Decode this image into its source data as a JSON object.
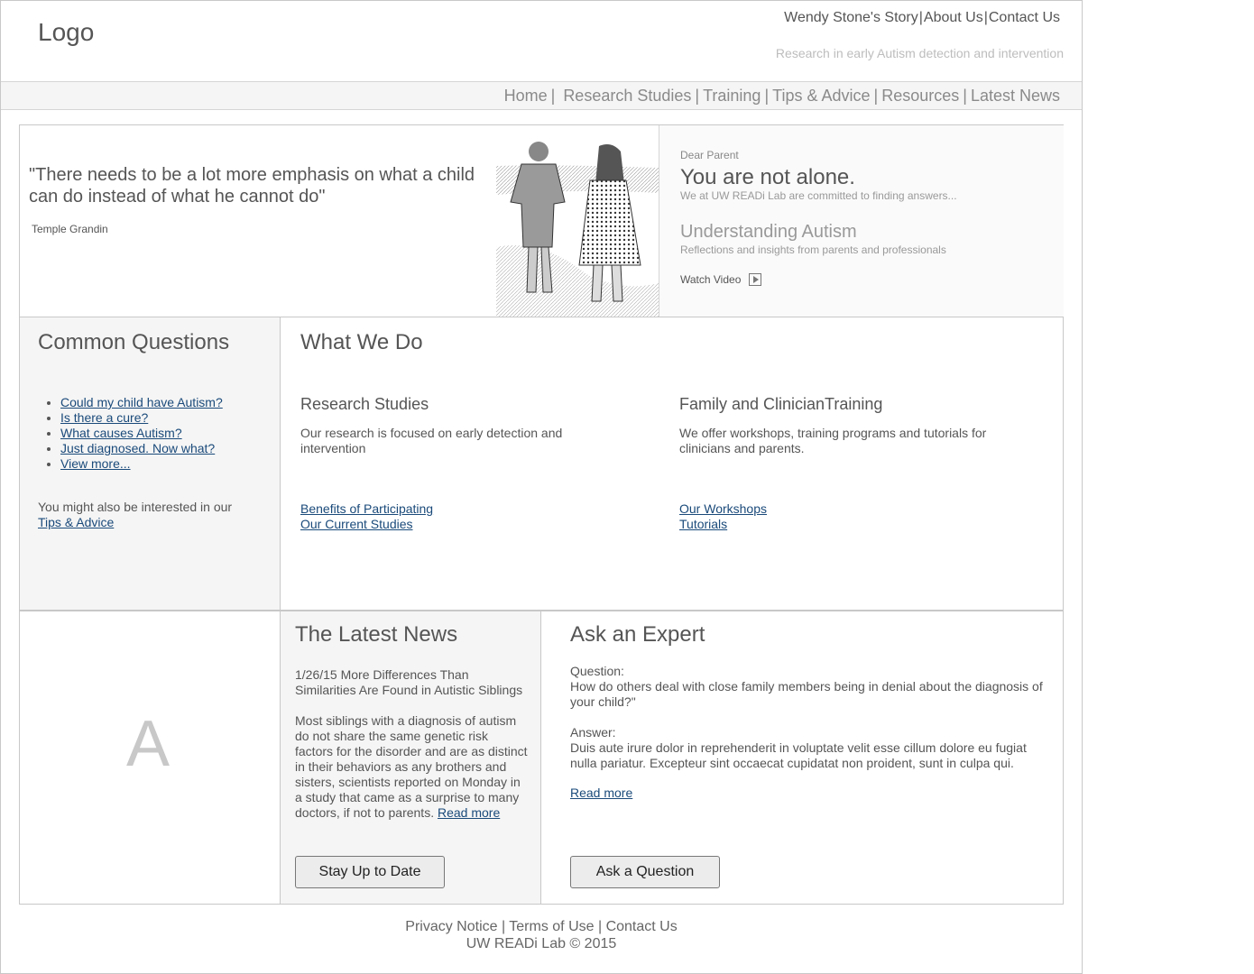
{
  "header": {
    "logo": "Logo",
    "top_links": [
      "Wendy Stone's Story",
      "About Us",
      "Contact Us"
    ],
    "tagline": "Research in early Autism detection and intervention"
  },
  "nav": {
    "items": [
      "Home",
      "Research Studies",
      "Training",
      "Tips & Advice",
      "Resources",
      "Latest News"
    ]
  },
  "hero": {
    "quote": "\"There needs to be a lot more emphasis on what a child can do instead of what he cannot do\"",
    "author": "Temple Grandin",
    "greeting": "Dear Parent",
    "headline": "You are not alone.",
    "headline_sub": "We at UW READi Lab are committed to finding answers...",
    "video_title": "Understanding Autism",
    "video_sub": "Reflections and insights from parents and professionals",
    "watch_label": "Watch Video"
  },
  "common_questions": {
    "title": "Common Questions",
    "items": [
      "Could my child have Autism?",
      "Is there a cure?",
      "What causes Autism?",
      "Just diagnosed. Now what?",
      "View more..."
    ],
    "also_text": "You might also be interested in our",
    "also_link": "Tips & Advice"
  },
  "what_we_do": {
    "title": "What We Do",
    "research": {
      "title": "Research Studies",
      "desc": "Our research is focused on early detection and intervention",
      "links": [
        "Benefits of Participating",
        "Our Current Studies"
      ]
    },
    "training": {
      "title": "Family and ClinicianTraining",
      "desc": "We offer workshops, training programs and tutorials for clinicians and parents.",
      "links": [
        "Our Workshops",
        "Tutorials"
      ]
    }
  },
  "ad": {
    "letter": "A"
  },
  "news": {
    "title": "The Latest News",
    "headline": "1/26/15 More Differences Than Similarities Are Found in Autistic Siblings",
    "body": "Most siblings with a diagnosis of autism do not share the same genetic risk factors for the disorder and are as distinct in their behaviors as any brothers and sisters, scientists reported on Monday in a study that came as a surprise to many doctors, if not to parents.",
    "read_more": "Read more",
    "button": "Stay Up to Date"
  },
  "expert": {
    "title": "Ask an Expert",
    "question_label": "Question:",
    "question": "How do others deal with close family members being in denial about the diagnosis of your child?\"",
    "answer_label": "Answer:",
    "answer": "Duis aute irure dolor in reprehenderit in voluptate velit esse cillum dolore eu fugiat nulla pariatur. Excepteur sint occaecat cupidatat non proident, sunt in culpa qui.",
    "read_more": "Read more",
    "button": "Ask a Question"
  },
  "footer": {
    "links": [
      "Privacy Notice",
      "Terms of Use",
      "Contact Us"
    ],
    "copyright": "UW READi Lab  © 2015"
  }
}
